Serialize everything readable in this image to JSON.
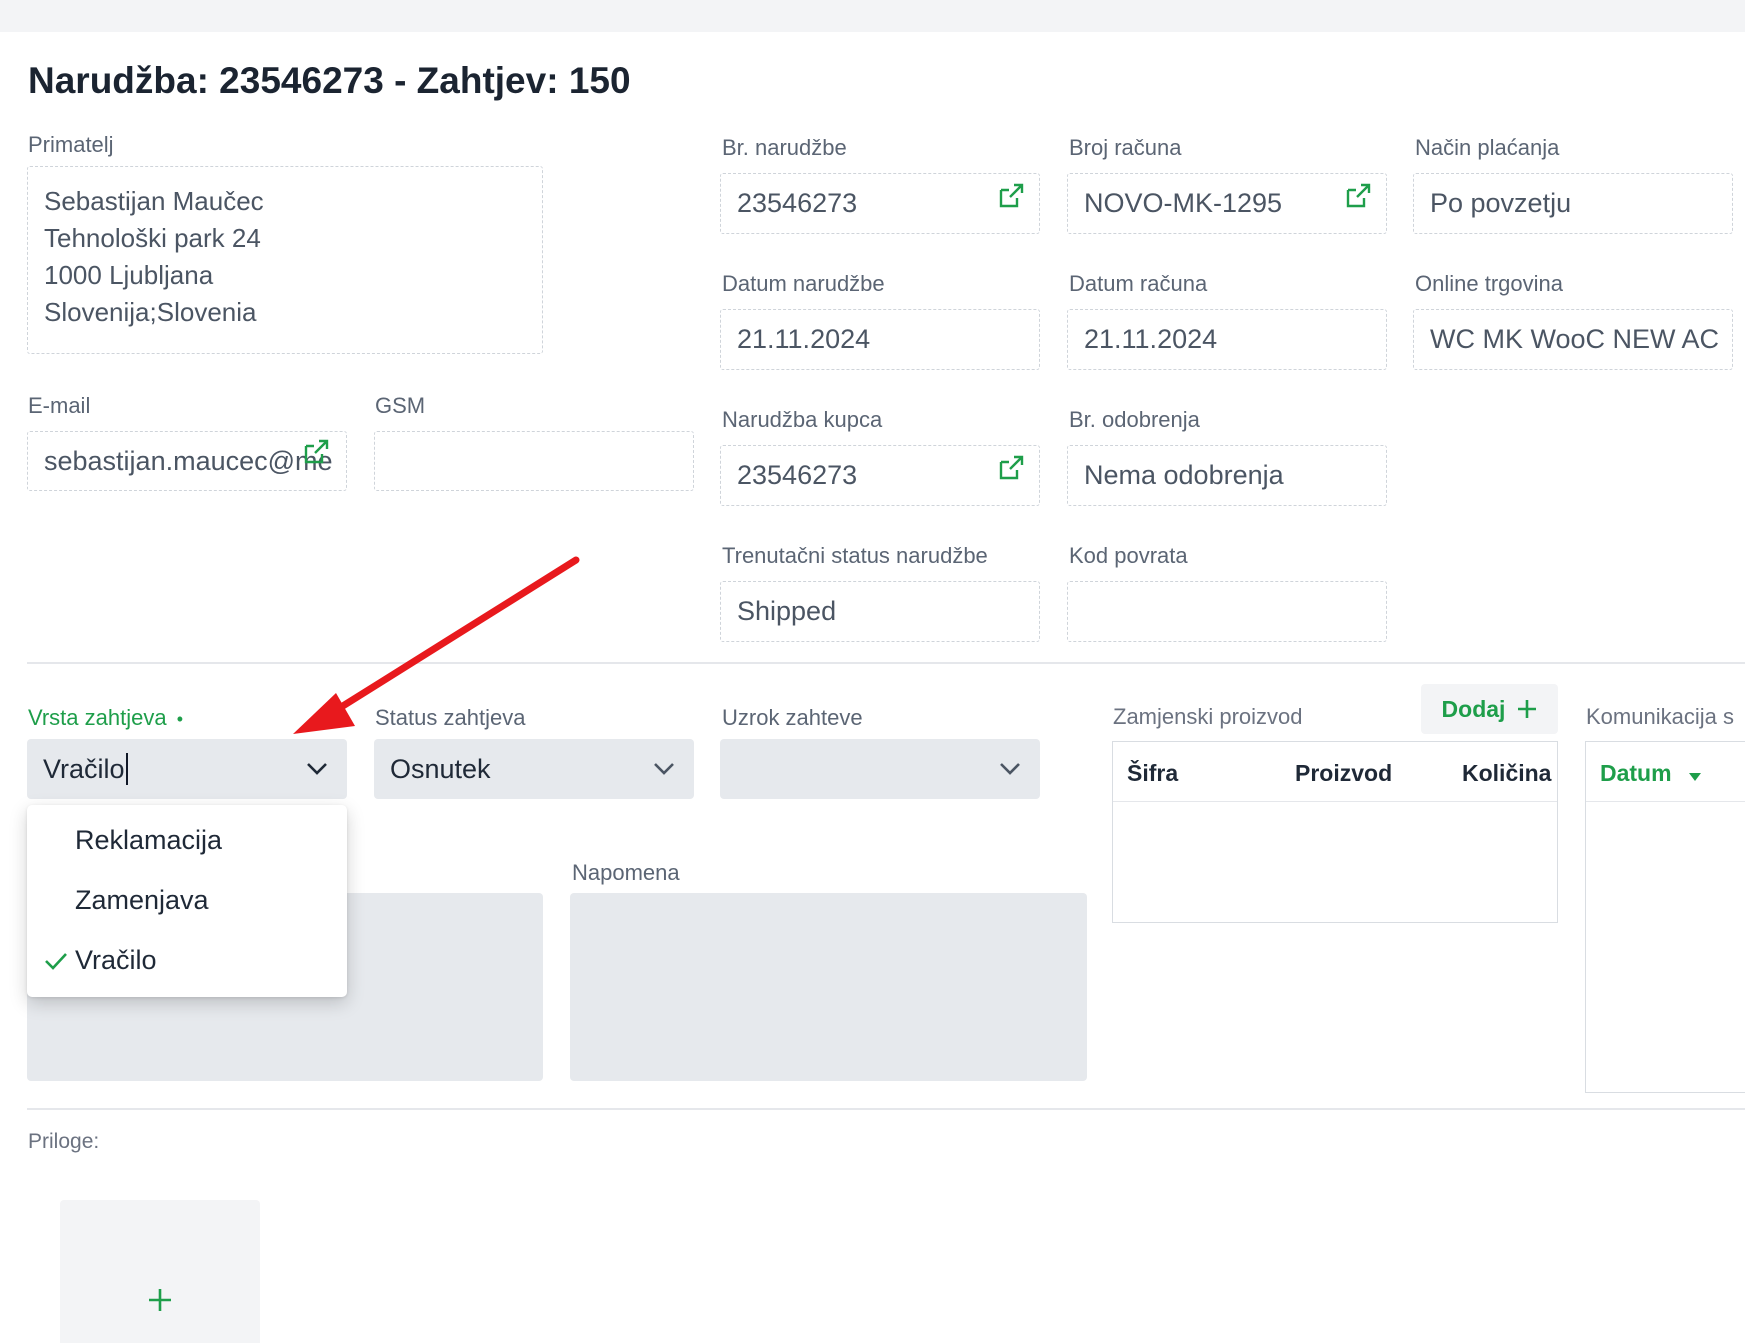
{
  "page": {
    "title": "Narudžba: 23546273 - Zahtjev: 150"
  },
  "recipient": {
    "label": "Primatelj",
    "lines": [
      "Sebastijan Maučec",
      "Tehnološki park 24",
      "1000 Ljubljana",
      "Slovenija;Slovenia"
    ]
  },
  "contact": {
    "email_label": "E-mail",
    "email_value": "sebastijan.maucec@me",
    "gsm_label": "GSM",
    "gsm_value": ""
  },
  "order": {
    "order_no_label": "Br. narudžbe",
    "order_no_value": "23546273",
    "invoice_no_label": "Broj računa",
    "invoice_no_value": "NOVO-MK-1295",
    "payment_label": "Način plaćanja",
    "payment_value": "Po povzetju",
    "order_date_label": "Datum narudžbe",
    "order_date_value": "21.11.2024",
    "invoice_date_label": "Datum računa",
    "invoice_date_value": "21.11.2024",
    "shop_label": "Online trgovina",
    "shop_value": "WC MK WooC NEW AC",
    "customer_order_label": "Narudžba kupca",
    "customer_order_value": "23546273",
    "approval_label": "Br. odobrenja",
    "approval_value": "Nema odobrenja",
    "status_label": "Trenutačni status narudžbe",
    "status_value": "Shipped",
    "return_code_label": "Kod povrata",
    "return_code_value": ""
  },
  "request": {
    "type_label": "Vrsta zahtjeva",
    "required_marker": "•",
    "type_value": "Vračilo",
    "status_label": "Status zahtjeva",
    "status_value": "Osnutek",
    "cause_label": "Uzrok zahteve",
    "cause_value": "",
    "note_label": "Napomena"
  },
  "type_dropdown": {
    "options": [
      "Reklamacija",
      "Zamenjava",
      "Vračilo"
    ],
    "selected_index": 2
  },
  "replacement": {
    "label": "Zamjenski proizvod",
    "add_label": "Dodaj",
    "columns": [
      "Šifra",
      "Proizvod",
      "Količina"
    ]
  },
  "communication": {
    "label": "Komunikacija s",
    "columns": [
      "Datum"
    ]
  },
  "attachments": {
    "label": "Priloge:"
  },
  "colors": {
    "accent": "#1e9e4a",
    "annotation_arrow": "#e8191d",
    "field_bg": "#e6e9ed"
  },
  "icons": {
    "external_link": "external-link-icon",
    "chevron": "chevron-down-icon",
    "check": "check-icon",
    "plus": "plus-icon",
    "sort": "sort-down-icon"
  }
}
